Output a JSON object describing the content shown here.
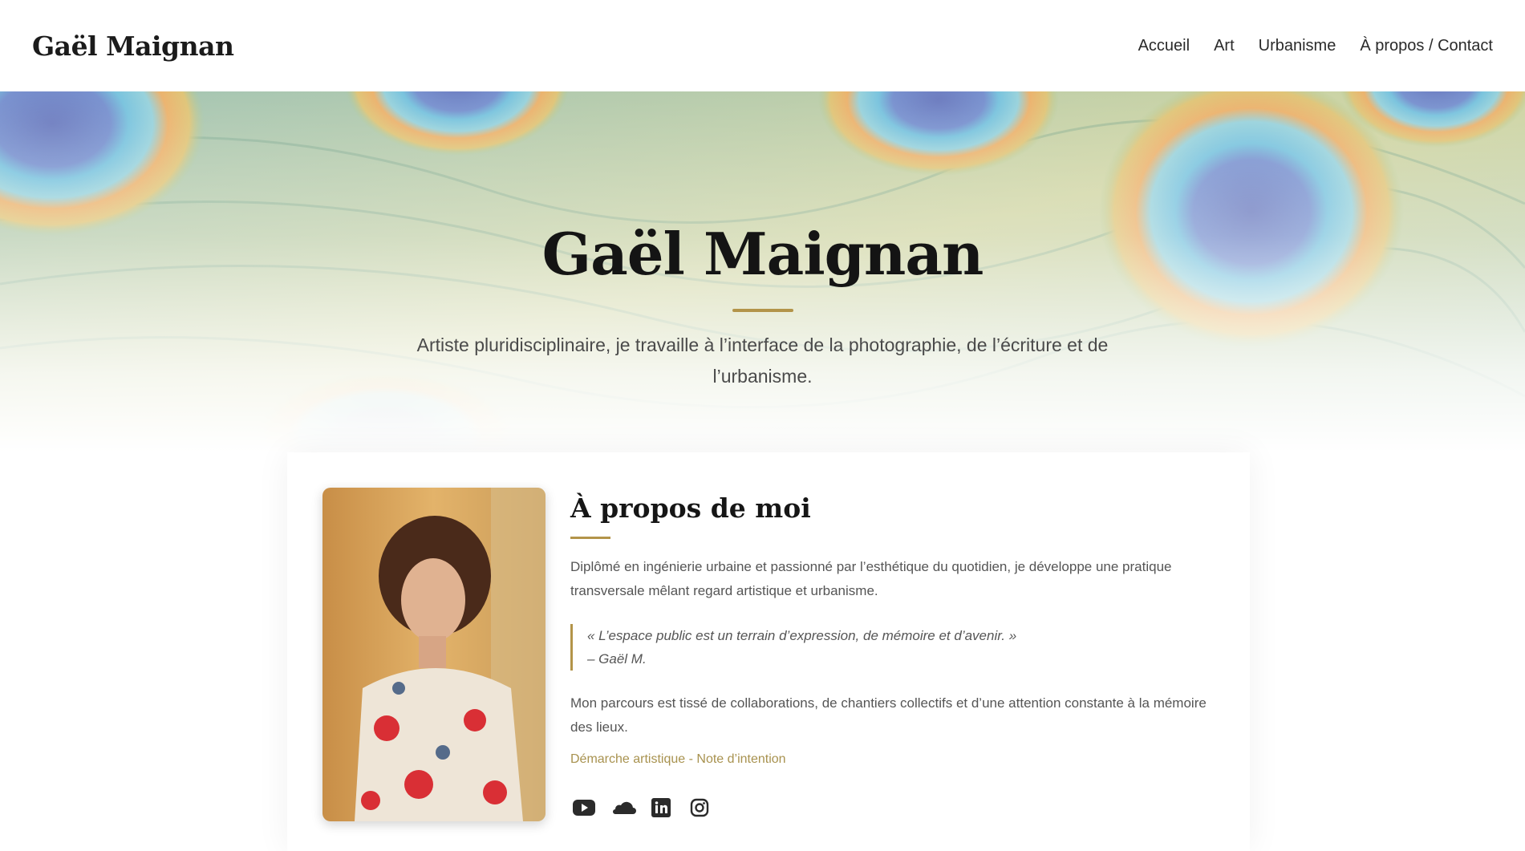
{
  "header": {
    "brand": "Gaël Maignan",
    "nav": [
      "Accueil",
      "Art",
      "Urbanisme",
      "À propos / Contact"
    ]
  },
  "hero": {
    "title": "Gaël Maignan",
    "subtitle": "Artiste pluridisciplinaire, je travaille à l’interface de la photographie, de l’écriture et de l’urbanisme."
  },
  "about": {
    "title": "À propos de moi",
    "paragraph1": "Diplômé en ingénierie urbaine et passionné par l’esthétique du quotidien, je développe une pratique transversale mêlant regard artistique et urbanisme.",
    "quote": "« L’espace public est un terrain d’expression, de mémoire et d’avenir. »",
    "quote_author": "– Gaël M.",
    "paragraph2": "Mon parcours est tissé de collaborations, de chantiers collectifs et d’une attention constante à la mémoire des lieux.",
    "link": "Démarche artistique - Note d’intention",
    "socials": [
      "youtube-icon",
      "soundcloud-icon",
      "linkedin-icon",
      "instagram-icon"
    ]
  },
  "colors": {
    "accent": "#b39449",
    "link": "#a8924f",
    "text": "#555555",
    "heading": "#161616"
  }
}
